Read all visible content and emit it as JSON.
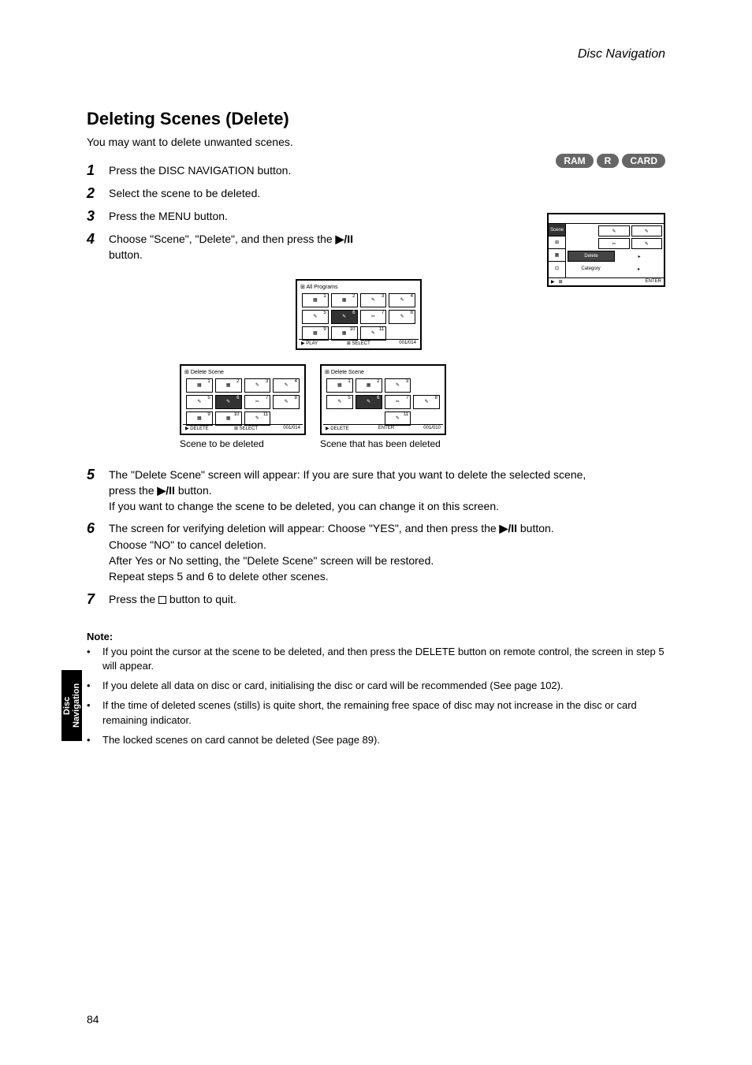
{
  "top_page_label": "Disc Navigation",
  "badges": [
    "RAM",
    "R",
    "CARD"
  ],
  "title": "Deleting Scenes (Delete)",
  "subtitle": "You may want to delete unwanted scenes.",
  "steps": {
    "s1": "Press the DISC NAVIGATION button.",
    "s2": "Select the scene to be deleted.",
    "s3": "Press the MENU button.",
    "s4a": "Choose \"Scene\", \"Delete\", and then press the",
    "s4b": "button.",
    "s5": "The \"Delete Scene\" screen will appear: If you are sure that you want to delete the selected scene, press the",
    "s5b": "button.",
    "s5c": "If you want to change the scene to be deleted, you can change it on this screen.",
    "s6a": "The screen for verifying deletion will appear: Choose \"YES\", and then press the",
    "s6b": "button.",
    "s6c": "Choose \"NO\" to cancel deletion.",
    "s6d": "After Yes or No setting, the \"Delete Scene\" screen will be restored.",
    "s6e": "Repeat steps 5 and 6 to delete other scenes.",
    "s7": "Press the",
    "s7b": "button to quit."
  },
  "disc_nav": {
    "tabs": [
      "Scene",
      "⊞",
      "▦",
      "⊡"
    ],
    "cells": {
      "delete": "Delete",
      "category": "Category"
    },
    "enter": "ENTER"
  },
  "thumb": {
    "header_all": "All Programs",
    "header_delete": "Delete Scene",
    "foot_play": "PLAY",
    "foot_sel": "SELECT",
    "foot_del": "DELETE",
    "foot_enter": "ENTER",
    "page_all": "001/014",
    "page_del": "001/014",
    "page_del2": "001/010",
    "caption1": "Scene to be deleted",
    "caption2": "Scene that has been deleted"
  },
  "notes": {
    "label": "Note:",
    "b1": "If you point the cursor at the scene to be deleted, and then press the DELETE button on remote control, the screen in step 5 will appear.",
    "b2": "If you delete all data on disc or card, initialising the disc or card will be recommended (See page 102).",
    "b3": "If the time of deleted scenes (stills) is quite short, the remaining free space of disc may not increase in the disc or card remaining indicator.",
    "b4": "The locked scenes on card cannot be deleted (See page 89)."
  },
  "side_tab": "Disc Navigation",
  "page_number": "84"
}
